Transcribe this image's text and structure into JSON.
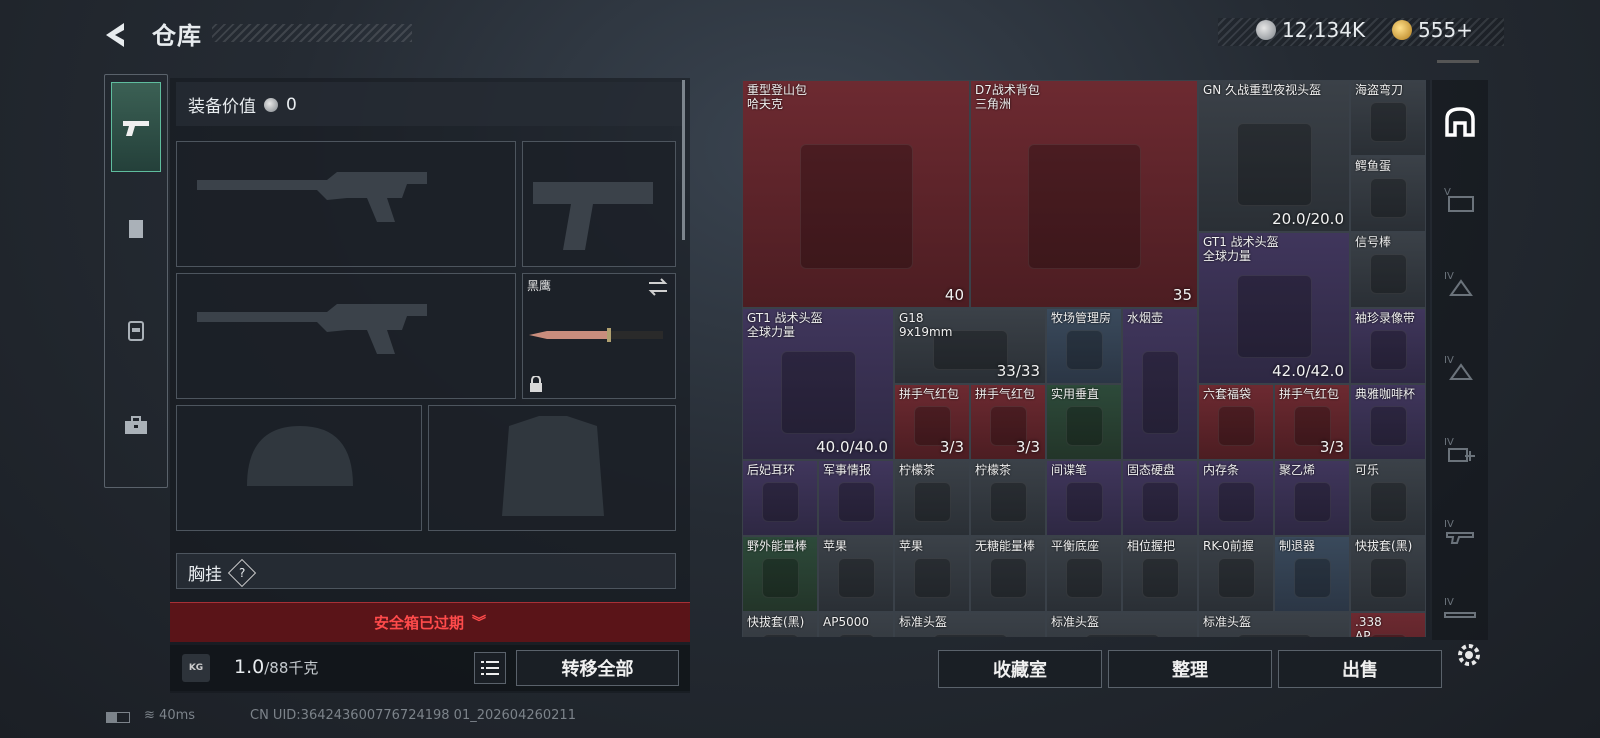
{
  "header": {
    "title": "仓库",
    "currency_a": "12,134K",
    "currency_b": "555+"
  },
  "equipment": {
    "value_label": "装备价值",
    "value": "0",
    "melee_name": "黑鹰",
    "chest_label": "胸挂",
    "chest_help": "?",
    "safe_box_status": "安全箱已过期",
    "weight_current": "1.0",
    "weight_max": "/88千克",
    "transfer_all": "转移全部"
  },
  "grid_items": [
    {
      "name": "重型登山包\n哈夫克",
      "count": "40",
      "rarity": "red"
    },
    {
      "name": "D7战术背包\n三角洲",
      "count": "35",
      "rarity": "red"
    },
    {
      "name": "GN 久战重型夜视头盔",
      "count": "20.0/20.0",
      "rarity": "gray"
    },
    {
      "name": "海盗弯刀",
      "count": "",
      "rarity": "gray"
    },
    {
      "name": "鳄鱼蛋",
      "count": "",
      "rarity": "gray"
    },
    {
      "name": "GT1 战术头盔\n全球力量",
      "count": "42.0/42.0",
      "rarity": "purple"
    },
    {
      "name": "信号棒",
      "count": "",
      "rarity": "gray"
    },
    {
      "name": "GT1 战术头盔\n全球力量",
      "count": "40.0/40.0",
      "rarity": "purple"
    },
    {
      "name": "G18\n9x19mm",
      "count": "33/33",
      "rarity": "gray"
    },
    {
      "name": "牧场管理房",
      "count": "",
      "rarity": "blue"
    },
    {
      "name": "水烟壶",
      "count": "",
      "rarity": "purple"
    },
    {
      "name": "袖珍录像带",
      "count": "",
      "rarity": "purple"
    },
    {
      "name": "拼手气红包",
      "count": "3/3",
      "rarity": "red"
    },
    {
      "name": "拼手气红包",
      "count": "3/3",
      "rarity": "red"
    },
    {
      "name": "实用垂直",
      "count": "",
      "rarity": "green"
    },
    {
      "name": "六套福袋",
      "count": "",
      "rarity": "red"
    },
    {
      "name": "拼手气红包",
      "count": "3/3",
      "rarity": "red"
    },
    {
      "name": "典雅咖啡杯",
      "count": "",
      "rarity": "purple"
    },
    {
      "name": "后妃耳环",
      "count": "",
      "rarity": "purple"
    },
    {
      "name": "军事情报",
      "count": "",
      "rarity": "purple"
    },
    {
      "name": "柠檬茶",
      "count": "",
      "rarity": "gray"
    },
    {
      "name": "柠檬茶",
      "count": "",
      "rarity": "gray"
    },
    {
      "name": "间谍笔",
      "count": "",
      "rarity": "purple"
    },
    {
      "name": "固态硬盘",
      "count": "",
      "rarity": "purple"
    },
    {
      "name": "内存条",
      "count": "",
      "rarity": "purple"
    },
    {
      "name": "聚乙烯",
      "count": "",
      "rarity": "purple"
    },
    {
      "name": "可乐",
      "count": "",
      "rarity": "gray"
    },
    {
      "name": "野外能量棒",
      "count": "",
      "rarity": "green"
    },
    {
      "name": "苹果",
      "count": "",
      "rarity": "gray"
    },
    {
      "name": "苹果",
      "count": "",
      "rarity": "gray"
    },
    {
      "name": "无糖能量棒",
      "count": "",
      "rarity": "gray"
    },
    {
      "name": "平衡底座",
      "count": "",
      "rarity": "gray"
    },
    {
      "name": "相位握把",
      "count": "",
      "rarity": "gray"
    },
    {
      "name": "RK-0前握",
      "count": "",
      "rarity": "gray"
    },
    {
      "name": "制退器",
      "count": "",
      "rarity": "blue"
    },
    {
      "name": "快拔套(黑)",
      "count": "",
      "rarity": "gray"
    },
    {
      "name": "快拔套(黑)",
      "count": "",
      "rarity": "gray"
    },
    {
      "name": "AP5000",
      "count": "",
      "rarity": "gray"
    },
    {
      "name": "标准头盔",
      "count": "",
      "rarity": "gray"
    },
    {
      "name": "标准头盔",
      "count": "",
      "rarity": "gray"
    },
    {
      "name": "标准头盔",
      "count": "",
      "rarity": "gray"
    },
    {
      "name": ".338\nAP",
      "count": "",
      "rarity": "red"
    }
  ],
  "actions": {
    "collection": "收藏室",
    "sort": "整理",
    "sell": "出售"
  },
  "footer": {
    "ping": "40ms",
    "uid": "CN UID:364243600776724198 01_202604260211"
  },
  "colors": {
    "accent_green": "#5fbd9e",
    "danger_red": "#ff4b4b"
  }
}
